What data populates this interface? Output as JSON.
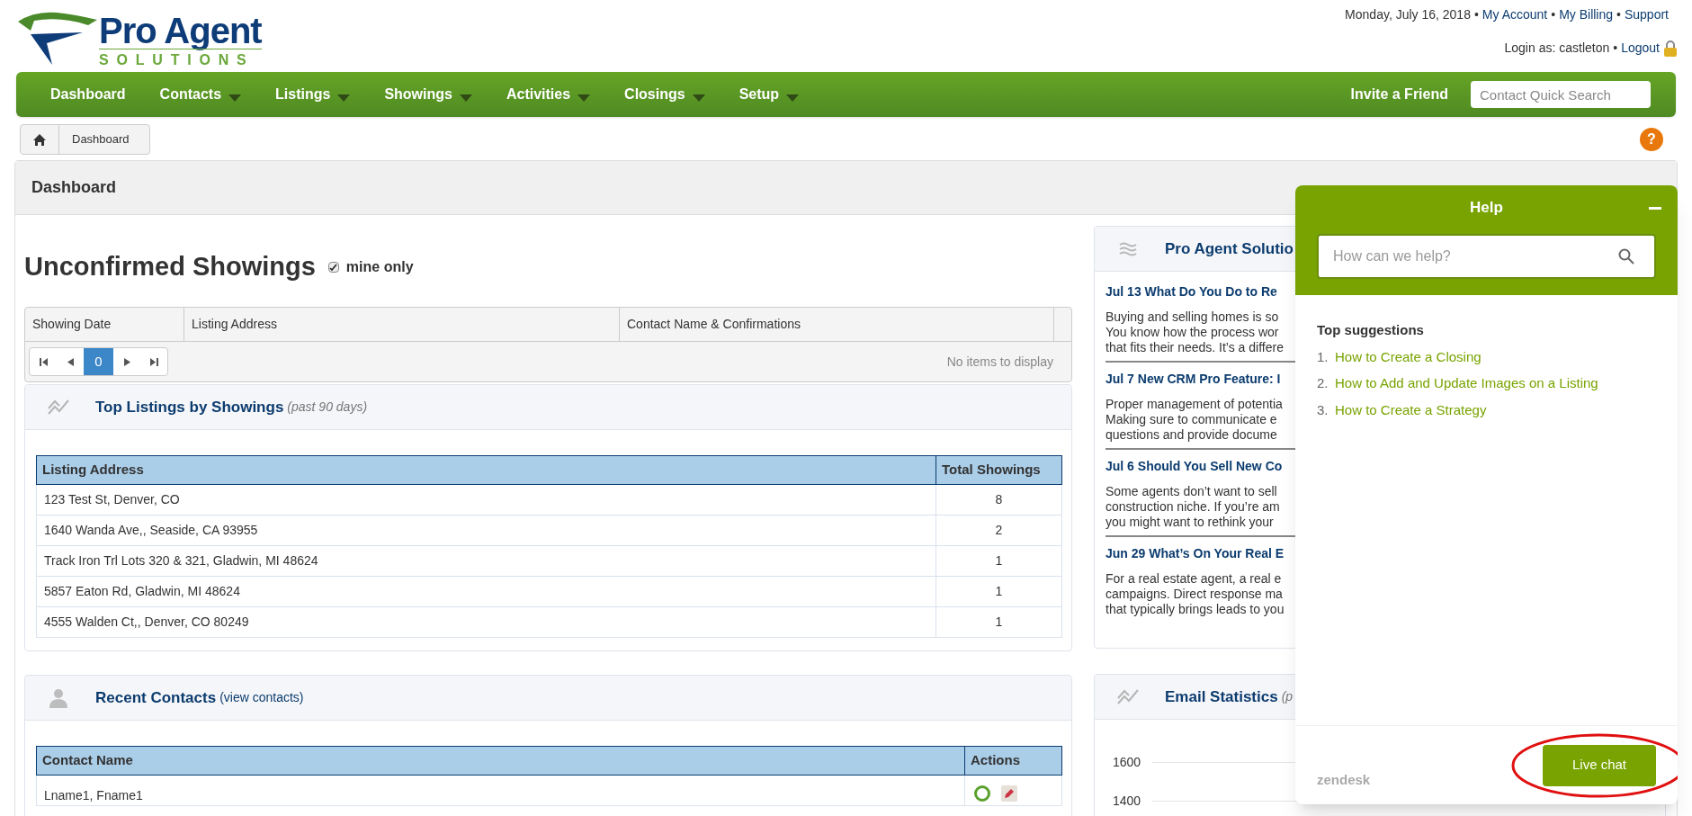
{
  "header": {
    "logo_top": "Pro Agent",
    "logo_bottom": "SOLUTIONS",
    "top_line": [
      {
        "kind": "text",
        "text": "Monday, July 16, 2018"
      },
      {
        "kind": "sep",
        "text": "•"
      },
      {
        "kind": "link",
        "text": "My Account"
      },
      {
        "kind": "sep",
        "text": "•"
      },
      {
        "kind": "link",
        "text": "My Billing"
      },
      {
        "kind": "sep",
        "text": "•"
      },
      {
        "kind": "link",
        "text": "Support"
      }
    ],
    "login_line": [
      {
        "kind": "text",
        "text": "Login as: castleton"
      },
      {
        "kind": "sep",
        "text": "•"
      },
      {
        "kind": "link",
        "text": "Logout"
      }
    ]
  },
  "help_button": "?",
  "nav": {
    "items": [
      {
        "label": "Dashboard",
        "dropdown": false
      },
      {
        "label": "Contacts",
        "dropdown": true
      },
      {
        "label": "Listings",
        "dropdown": true
      },
      {
        "label": "Showings",
        "dropdown": true
      },
      {
        "label": "Activities",
        "dropdown": true
      },
      {
        "label": "Closings",
        "dropdown": true
      },
      {
        "label": "Setup",
        "dropdown": true
      }
    ],
    "invite": "Invite a Friend",
    "search_placeholder": "Contact Quick Search"
  },
  "breadcrumb": [
    "Dashboard"
  ],
  "page_title": "Dashboard",
  "unconfirmed": {
    "title": "Unconfirmed Showings",
    "mine_only": {
      "label": "mine only",
      "checked": true
    },
    "columns": [
      "Showing Date",
      "Listing Address",
      "Contact Name & Confirmations"
    ],
    "page": "0",
    "empty": "No items to display"
  },
  "top_listings": {
    "title": "Top Listings by Showings",
    "note": "(past 90 days)",
    "columns": [
      "Listing Address",
      "Total Showings"
    ],
    "rows": [
      [
        "123 Test St, Denver, CO",
        "8"
      ],
      [
        "1640 Wanda Ave,, Seaside, CA 93955",
        "2"
      ],
      [
        "Track Iron Trl Lots 320 & 321, Gladwin, MI 48624",
        "1"
      ],
      [
        "5857 Eaton Rd, Gladwin, MI 48624",
        "1"
      ],
      [
        "4555 Walden Ct,, Denver, CO 80249",
        "1"
      ]
    ]
  },
  "recent_contacts": {
    "title": "Recent Contacts",
    "link": "(view contacts)",
    "columns": [
      "Contact Name",
      "Actions"
    ],
    "rows": [
      "Lname1, Fname1"
    ]
  },
  "news": {
    "title": "Pro Agent Solutio",
    "items": [
      {
        "heading": "Jul 13 What Do You Do to Re",
        "lines": [
          "Buying and selling homes is so",
          "You know how the process wor",
          "that fits their needs. It’s a differe"
        ]
      },
      {
        "heading": "Jul 7 New CRM Pro Feature: I",
        "lines": [
          "Proper management of potentia",
          "Making sure to communicate e",
          "questions and provide docume"
        ]
      },
      {
        "heading": "Jul 6 Should You Sell New Co",
        "lines": [
          "Some agents don’t want to sell",
          "construction niche. If you’re am",
          "you might want to rethink your"
        ]
      },
      {
        "heading": "Jun 29 What’s On Your Real E",
        "lines": [
          "For a real estate agent, a real e",
          "campaigns. Direct response ma",
          "that typically brings leads to you"
        ]
      }
    ]
  },
  "email_stats": {
    "title": "Email Statistics",
    "note": "(p",
    "y_labels": [
      "1600",
      "1400"
    ]
  },
  "help": {
    "title": "Help",
    "placeholder": "How can we help?",
    "suggestions_title": "Top suggestions",
    "suggestions": [
      {
        "number": "1.",
        "text": "How to Create a Closing"
      },
      {
        "number": "2.",
        "text": "How to Add and Update Images on a Listing"
      },
      {
        "number": "3.",
        "text": "How to Create a Strategy"
      }
    ],
    "brand": "zendesk",
    "live_chat": "Live chat"
  }
}
